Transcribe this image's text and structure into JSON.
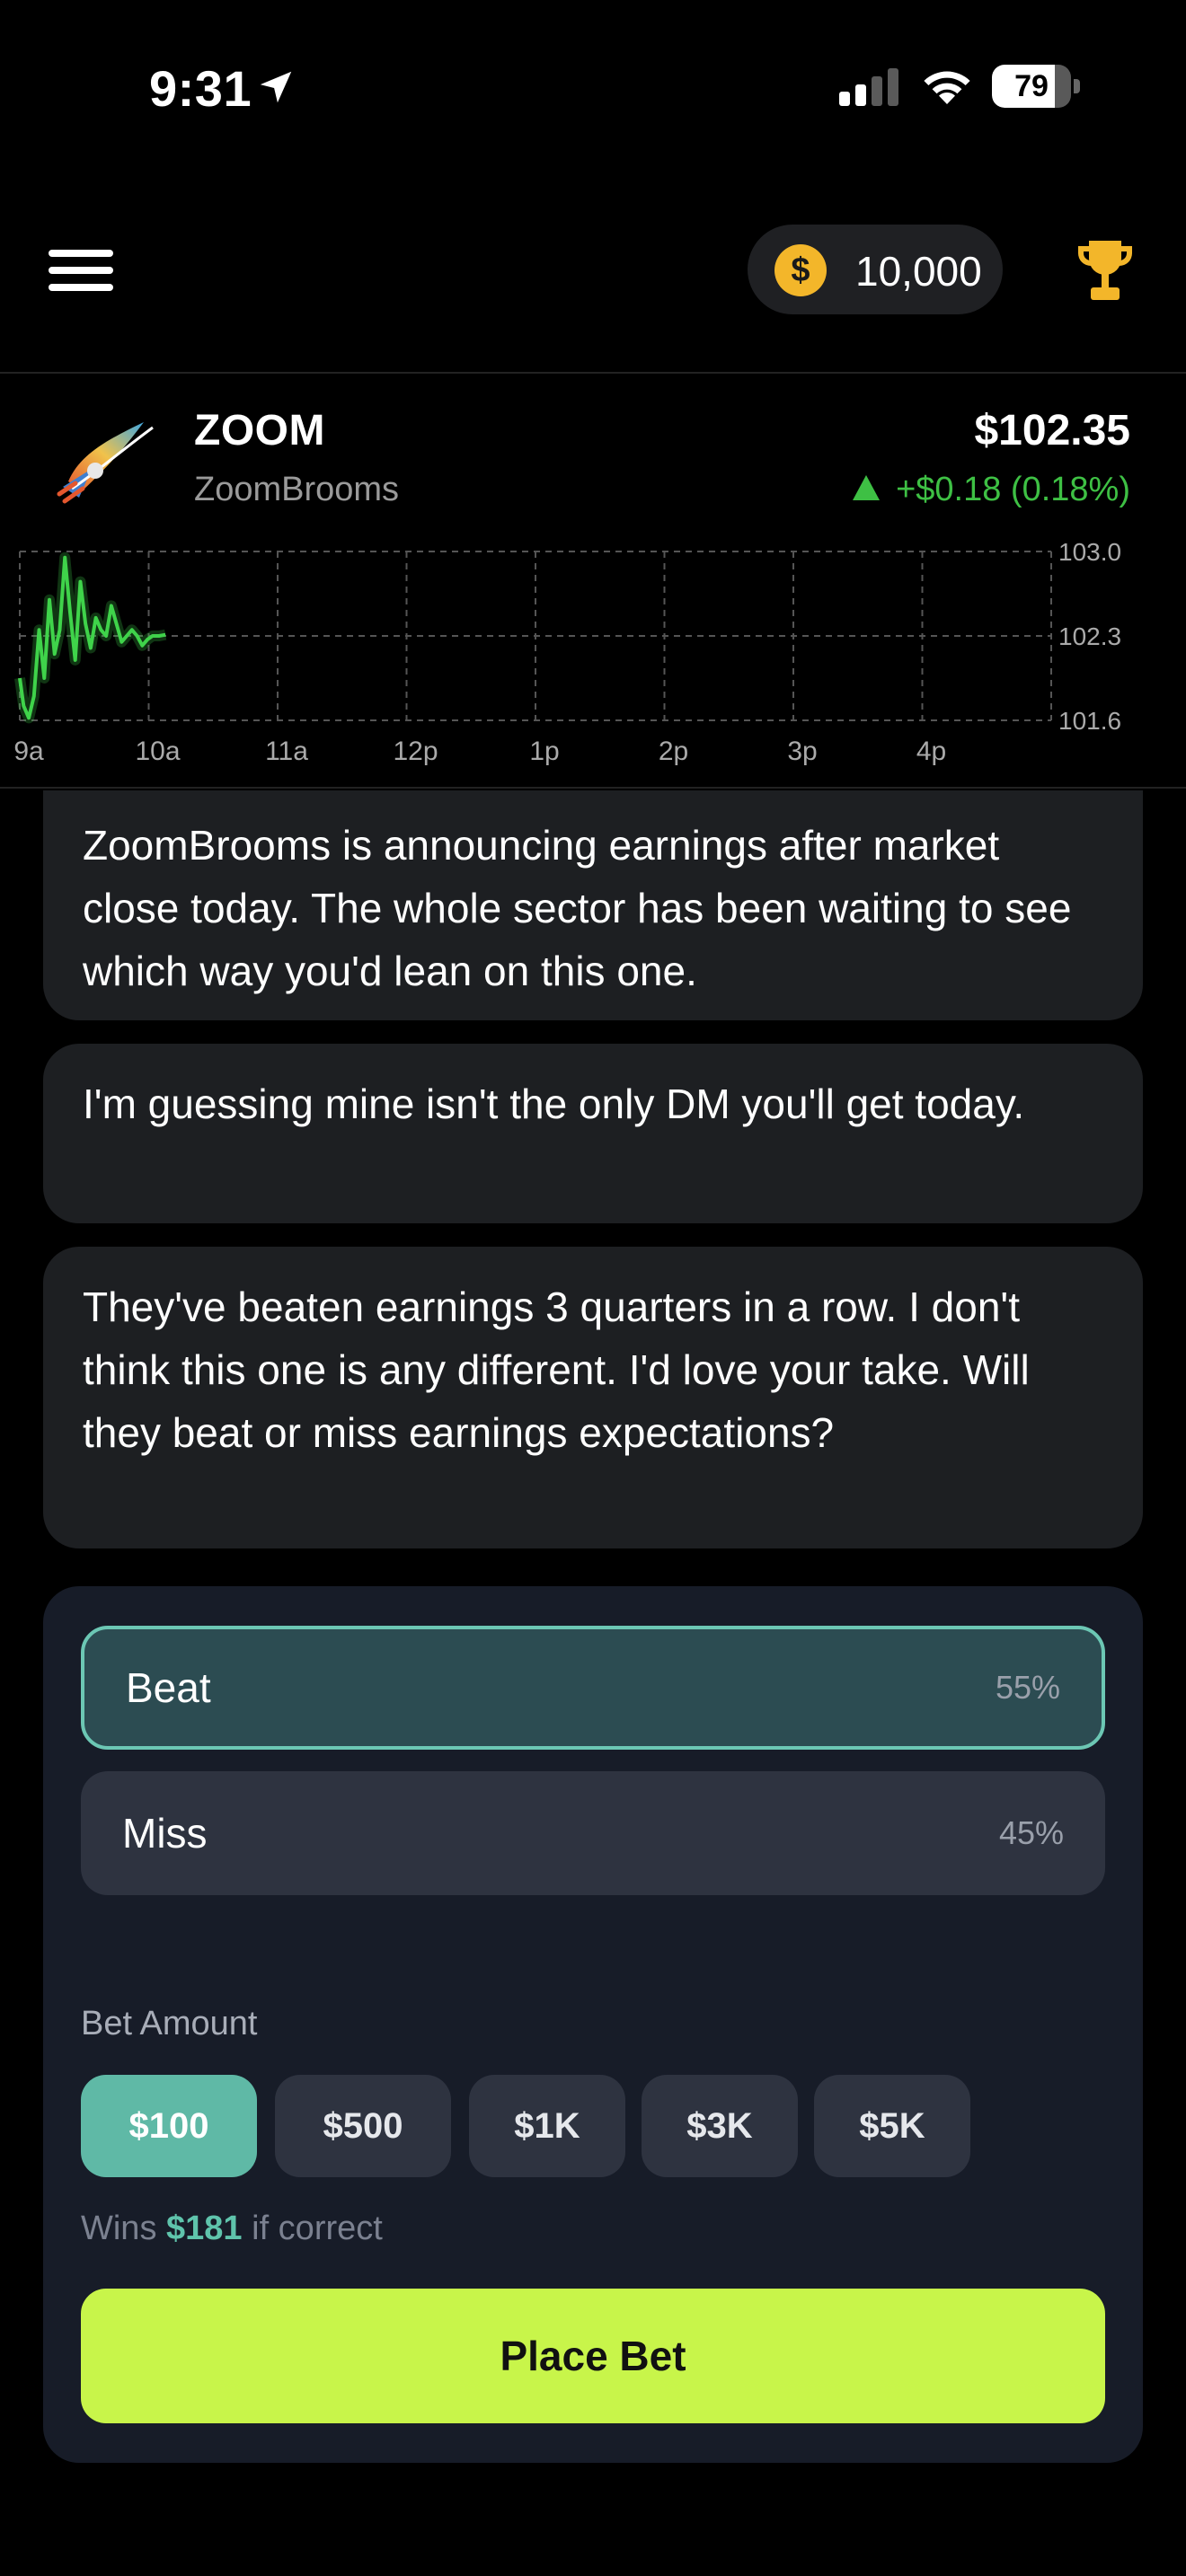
{
  "status_bar": {
    "time": "9:31",
    "battery": "79",
    "battery_level": 0.79
  },
  "header": {
    "coin_symbol": "$",
    "balance": "10,000"
  },
  "ticker": {
    "symbol": "ZOOM",
    "name": "ZoomBrooms",
    "price": "$102.35",
    "change": "+$0.18 (0.18%)"
  },
  "chart_data": {
    "type": "line",
    "x_ticks": [
      "9a",
      "10a",
      "11a",
      "12p",
      "1p",
      "2p",
      "3p",
      "4p"
    ],
    "y_ticks": [
      "103.0",
      "102.3",
      "101.6"
    ],
    "ylim": [
      101.6,
      103.0
    ],
    "grid": true,
    "series": [
      {
        "color": "#3fd34a",
        "x": [
          0,
          0.03,
          0.07,
          0.11,
          0.15,
          0.19,
          0.23,
          0.27,
          0.31,
          0.35,
          0.39,
          0.43,
          0.47,
          0.51,
          0.55,
          0.59,
          0.63,
          0.67,
          0.71,
          0.75,
          0.79,
          0.83,
          0.87,
          0.91,
          0.95,
          0.99,
          1.03,
          1.08,
          1.13
        ],
        "y": [
          101.95,
          101.72,
          101.62,
          101.8,
          102.35,
          101.95,
          102.6,
          102.15,
          102.35,
          102.95,
          102.5,
          102.1,
          102.75,
          102.4,
          102.2,
          102.45,
          102.35,
          102.3,
          102.55,
          102.4,
          102.25,
          102.3,
          102.35,
          102.3,
          102.22,
          102.27,
          102.3,
          102.3,
          102.31
        ]
      }
    ]
  },
  "messages": [
    "ZoomBrooms is announcing earnings after market close today. The whole sector has been waiting to see which way you'd lean on this one.",
    "I'm guessing mine isn't the only DM you'll get today.",
    "They've beaten earnings 3 quarters in a row. I don't think this one is any different. I'd love your take. Will they beat or miss earnings expectations?"
  ],
  "bet": {
    "options": [
      {
        "label": "Beat",
        "pct": "55%"
      },
      {
        "label": "Miss",
        "pct": "45%"
      }
    ],
    "amount_label": "Bet Amount",
    "amounts": [
      "$100",
      "$500",
      "$1K",
      "$3K",
      "$5K"
    ],
    "wins_prefix": "Wins",
    "wins_amount": "$181",
    "wins_suffix": "if correct",
    "place_label": "Place Bet",
    "colors": {
      "accent": "#5fb9a6",
      "cta": "#c8f54a",
      "up": "#3ec044"
    }
  }
}
